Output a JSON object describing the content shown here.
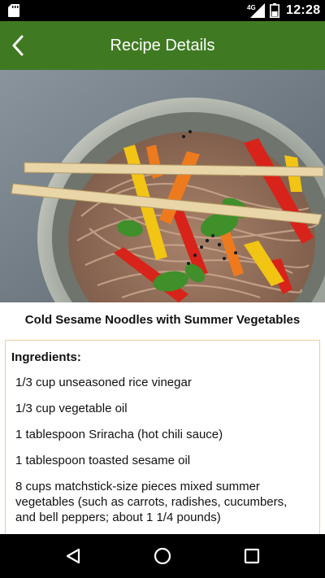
{
  "status_bar": {
    "network_label": "4G",
    "time": "12:28",
    "icons": [
      "sd-card-icon",
      "signal-icon",
      "battery-icon"
    ]
  },
  "app_bar": {
    "title": "Recipe Details",
    "back_icon": "chevron-left-icon",
    "background_color": "#3f7a22"
  },
  "recipe": {
    "title": "Cold Sesame Noodles with Summer Vegetables",
    "ingredients_heading": "Ingredients:",
    "ingredients": [
      "1/3 cup unseasoned rice vinegar",
      "1/3 cup vegetable oil",
      "1 tablespoon Sriracha (hot chili sauce)",
      "1 tablespoon toasted sesame oil",
      "8 cups matchstick-size pieces mixed summer vegetables (such as carrots, radishes, cucumbers, and bell peppers; about 1 1/4 pounds)"
    ],
    "card_border_color": "#f3c99a"
  },
  "nav_bar": {
    "buttons": [
      "back-triangle-icon",
      "home-circle-icon",
      "recents-square-icon"
    ]
  }
}
